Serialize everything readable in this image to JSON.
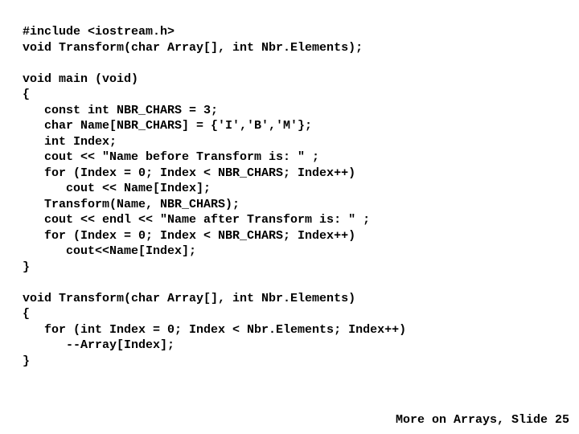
{
  "code": {
    "l01": "#include <iostream.h>",
    "l02": "void Transform(char Array[], int Nbr.Elements);",
    "l03": "",
    "l04": "void main (void)",
    "l05": "{",
    "l06": "   const int NBR_CHARS = 3;",
    "l07": "   char Name[NBR_CHARS] = {'I','B','M'};",
    "l08": "   int Index;",
    "l09": "   cout << \"Name before Transform is: \" ;",
    "l10": "   for (Index = 0; Index < NBR_CHARS; Index++)",
    "l11": "      cout << Name[Index];",
    "l12": "   Transform(Name, NBR_CHARS);",
    "l13": "   cout << endl << \"Name after Transform is: \" ;",
    "l14": "   for (Index = 0; Index < NBR_CHARS; Index++)",
    "l15": "      cout<<Name[Index];",
    "l16": "}",
    "l17": "",
    "l18": "void Transform(char Array[], int Nbr.Elements)",
    "l19": "{",
    "l20": "   for (int Index = 0; Index < Nbr.Elements; Index++)",
    "l21": "      --Array[Index];",
    "l22": "}"
  },
  "footer": "More on Arrays, Slide 25"
}
